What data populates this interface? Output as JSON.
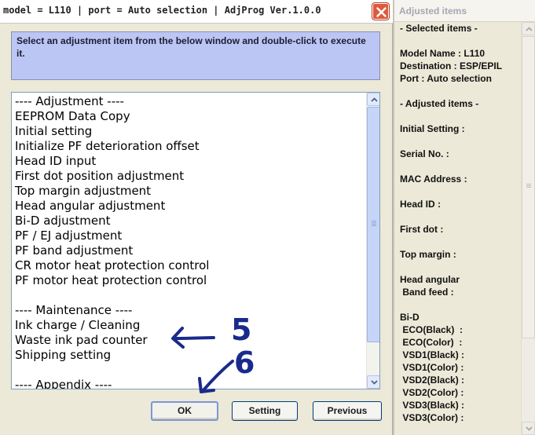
{
  "window": {
    "title": "model = L110  |  port = Auto selection  |  AdjProg Ver.1.0.0"
  },
  "instruction": "Select an adjustment item from the below window and double-click to execute it.",
  "list": {
    "items": [
      "---- Adjustment ----",
      "EEPROM Data Copy",
      "Initial setting",
      "Initialize PF deterioration offset",
      "Head ID input",
      "First dot position adjustment",
      "Top margin adjustment",
      "Head angular adjustment",
      "Bi-D adjustment",
      "PF / EJ adjustment",
      "PF band adjustment",
      "CR motor heat protection control",
      "PF motor heat protection control",
      "",
      "---- Maintenance ----",
      "Ink charge / Cleaning",
      "Waste ink pad counter",
      "Shipping setting",
      "",
      "---- Appendix ----"
    ]
  },
  "buttons": {
    "ok": "OK",
    "setting": "Setting",
    "previous": "Previous"
  },
  "annotations": {
    "five": "5",
    "six": "6",
    "color": "#1a2a8c"
  },
  "side_panel": {
    "title": "Adjusted items",
    "lines": [
      "- Selected items -",
      "",
      "Model Name : L110",
      "Destination : ESP/EPIL",
      "Port : Auto selection",
      "",
      "- Adjusted items -",
      "",
      "Initial Setting :",
      "",
      "Serial No. :",
      "",
      "MAC Address :",
      "",
      "Head ID :",
      "",
      "First dot :",
      "",
      "Top margin :",
      "",
      "Head angular",
      " Band feed :",
      "",
      "Bi-D",
      " ECO(Black)  :",
      " ECO(Color)  :",
      " VSD1(Black) :",
      " VSD1(Color) :",
      " VSD2(Black) :",
      " VSD2(Color) :",
      " VSD3(Black) :",
      " VSD3(Color) :"
    ]
  },
  "icons": {
    "close": "close-icon",
    "scroll_up": "arrow-up-icon",
    "scroll_down": "arrow-down-icon"
  },
  "colors": {
    "close_button": "#dd5a3c",
    "instruction_bg": "#bcc6f4",
    "dialog_bg": "#ece9d8"
  }
}
